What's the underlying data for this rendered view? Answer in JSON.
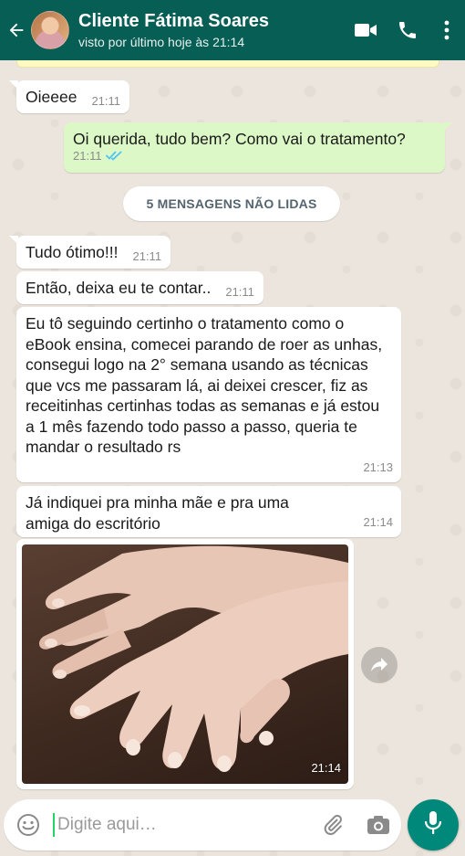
{
  "header": {
    "contact_name": "Cliente Fátima Soares",
    "last_seen": "visto por último hoje às 21:14",
    "icons": [
      "back-arrow-icon",
      "video-call-icon",
      "phone-icon",
      "more-options-icon"
    ]
  },
  "messages": [
    {
      "text": "Oieeee",
      "time": "21:11",
      "direction": "in"
    },
    {
      "text": "Oi querida, tudo bem? Como vai o tratamento?",
      "time": "21:11",
      "direction": "out",
      "status": "read"
    },
    {
      "text": "Tudo ótimo!!!",
      "time": "21:11",
      "direction": "in"
    },
    {
      "text": "Então, deixa eu te contar..",
      "time": "21:11",
      "direction": "in"
    },
    {
      "text": "Eu tô seguindo certinho o tratamento como o eBook ensina, comecei parando de roer as unhas, consegui logo na 2° semana usando as técnicas que vcs me passaram lá, ai deixei crescer, fiz as receitinhas certinhas todas as semanas e já estou a 1 mês fazendo todo passo a passo, queria te mandar o resultado rs",
      "time": "21:13",
      "direction": "in"
    },
    {
      "text": "Já indiquei pra minha mãe e pra uma amiga do escritório",
      "time": "21:14",
      "direction": "in"
    },
    {
      "image": "hands-photo",
      "time": "21:14",
      "direction": "in"
    }
  ],
  "unread_banner": "5 MENSAGENS NÃO LIDAS",
  "composer": {
    "placeholder": "Digite aqui…",
    "icons": [
      "emoji-icon",
      "attach-icon",
      "camera-icon",
      "mic-icon"
    ]
  },
  "colors": {
    "header": "#075e54",
    "outgoing_bubble": "#dcf8c6",
    "incoming_bubble": "#ffffff",
    "read_ticks": "#4fc3f7",
    "mic_button": "#00897b"
  }
}
